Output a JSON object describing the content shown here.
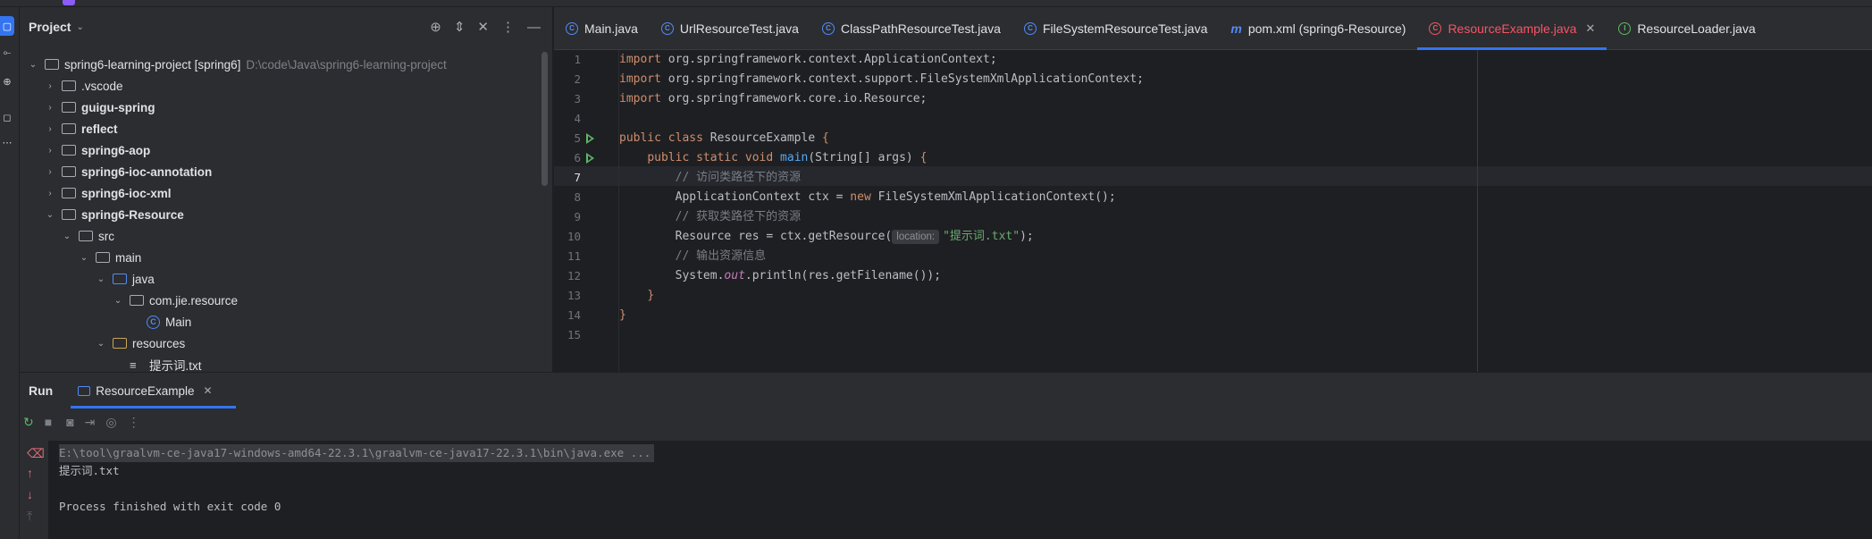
{
  "project_panel": {
    "title": "Project",
    "tree": [
      {
        "label": "spring6-learning-project [spring6]",
        "sub": "D:\\code\\Java\\spring6-learning-project",
        "depth": 0,
        "arrow": "open",
        "icon": "folder-module",
        "bold": false
      },
      {
        "label": ".vscode",
        "depth": 1,
        "arrow": "closed",
        "icon": "folder",
        "bold": false
      },
      {
        "label": "guigu-spring",
        "depth": 1,
        "arrow": "closed",
        "icon": "folder-module",
        "bold": true
      },
      {
        "label": "reflect",
        "depth": 1,
        "arrow": "closed",
        "icon": "folder-module",
        "bold": true
      },
      {
        "label": "spring6-aop",
        "depth": 1,
        "arrow": "closed",
        "icon": "folder-module",
        "bold": true
      },
      {
        "label": "spring6-ioc-annotation",
        "depth": 1,
        "arrow": "closed",
        "icon": "folder-module",
        "bold": true
      },
      {
        "label": "spring6-ioc-xml",
        "depth": 1,
        "arrow": "closed",
        "icon": "folder-module",
        "bold": true
      },
      {
        "label": "spring6-Resource",
        "depth": 1,
        "arrow": "open",
        "icon": "folder-module",
        "bold": true
      },
      {
        "label": "src",
        "depth": 2,
        "arrow": "open",
        "icon": "folder",
        "bold": false
      },
      {
        "label": "main",
        "depth": 3,
        "arrow": "open",
        "icon": "folder",
        "bold": false
      },
      {
        "label": "java",
        "depth": 4,
        "arrow": "open",
        "icon": "folder-source",
        "bold": false
      },
      {
        "label": "com.jie.resource",
        "depth": 5,
        "arrow": "open",
        "icon": "folder-package",
        "bold": false
      },
      {
        "label": "Main",
        "depth": 6,
        "arrow": "none",
        "icon": "class",
        "bold": false
      },
      {
        "label": "resources",
        "depth": 4,
        "arrow": "open",
        "icon": "folder-resources",
        "bold": false
      },
      {
        "label": "提示词.txt",
        "depth": 5,
        "arrow": "none",
        "icon": "text-file",
        "bold": false
      }
    ]
  },
  "editor_tabs": [
    {
      "label": "Main.java",
      "icon": "class",
      "active": false,
      "closable": false
    },
    {
      "label": "UrlResourceTest.java",
      "icon": "class",
      "active": false,
      "closable": false
    },
    {
      "label": "ClassPathResourceTest.java",
      "icon": "class",
      "active": false,
      "closable": false
    },
    {
      "label": "FileSystemResourceTest.java",
      "icon": "class",
      "active": false,
      "closable": false
    },
    {
      "label": "pom.xml (spring6-Resource)",
      "icon": "maven",
      "active": false,
      "closable": false
    },
    {
      "label": "ResourceExample.java",
      "icon": "class",
      "active": true,
      "closable": true
    },
    {
      "label": "ResourceLoader.java",
      "icon": "interface",
      "active": false,
      "closable": false
    }
  ],
  "editor": {
    "line_numbers": [
      "1",
      "2",
      "3",
      "4",
      "5",
      "6",
      "7",
      "8",
      "9",
      "10",
      "11",
      "12",
      "13",
      "14",
      "15"
    ],
    "current_line": "7",
    "run_gutter_lines": [
      "5",
      "6"
    ],
    "code": {
      "l1": {
        "kw": "import",
        "rest": " org.springframework.context.ApplicationContext;"
      },
      "l2": {
        "kw": "import",
        "rest": " org.springframework.context.support.FileSystemXmlApplicationContext;"
      },
      "l3": {
        "kw": "import",
        "rest": " org.springframework.core.io.Resource;"
      },
      "l5": {
        "kw1": "public",
        "kw2": "class",
        "name": "ResourceExample",
        "brace": "{"
      },
      "l6": {
        "kw1": "public",
        "kw2": "static",
        "kw3": "void",
        "fn": "main",
        "args": "(String[] args)",
        "brace": "{"
      },
      "l7": {
        "comment": "// 访问类路径下的资源"
      },
      "l8": {
        "pre": "ApplicationContext ctx = ",
        "kw": "new",
        "post": " FileSystemXmlApplicationContext();"
      },
      "l9": {
        "comment": "// 获取类路径下的资源"
      },
      "l10": {
        "pre": "Resource res = ctx.getResource(",
        "hint": "location:",
        "str": "\"提示词.txt\"",
        "post": ");"
      },
      "l11": {
        "comment": "// 输出资源信息"
      },
      "l12": {
        "pre": "System.",
        "field": "out",
        "post": ".println(res.getFilename());"
      },
      "l13": {
        "brace": "}"
      },
      "l14": {
        "brace": "}"
      }
    }
  },
  "run_panel": {
    "title": "Run",
    "tab_label": "ResourceExample",
    "console": {
      "command": "E:\\tool\\graalvm-ce-java17-windows-amd64-22.3.1\\graalvm-ce-java17-22.3.1\\bin\\java.exe ...",
      "output": "提示词.txt",
      "exit": "Process finished with exit code 0"
    }
  },
  "colors": {
    "keyword": "#cf8e6d",
    "method": "#56a8f5",
    "comment": "#7a7e85",
    "string": "#6aab73",
    "static_field": "#c77dbb",
    "active_tab": "#f75464",
    "accent": "#3574f0"
  }
}
